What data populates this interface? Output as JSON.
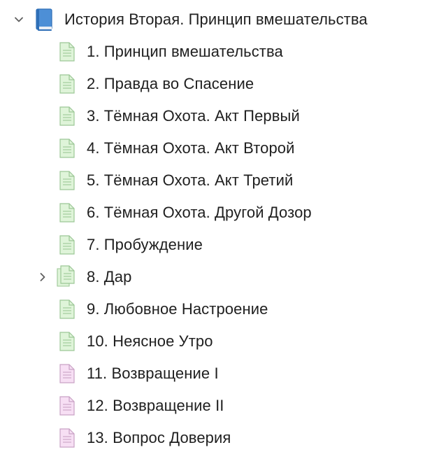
{
  "root": {
    "title": "История Вторая. Принцип вмешательства",
    "expanded": true,
    "icon": "book-icon"
  },
  "items": [
    {
      "label": "1. Принцип вмешательства",
      "icon": "document-green-icon",
      "color": "#dff4d9"
    },
    {
      "label": "2. Правда во Спасение",
      "icon": "document-green-icon",
      "color": "#dff4d9"
    },
    {
      "label": "3. Тёмная Охота. Акт Первый",
      "icon": "document-green-icon",
      "color": "#dff4d9"
    },
    {
      "label": "4. Тёмная Охота. Акт Второй",
      "icon": "document-green-icon",
      "color": "#dff4d9"
    },
    {
      "label": "5. Тёмная Охота. Акт Третий",
      "icon": "document-green-icon",
      "color": "#dff4d9"
    },
    {
      "label": "6. Тёмная Охота. Другой Дозор",
      "icon": "document-green-icon",
      "color": "#dff4d9"
    },
    {
      "label": "7. Пробуждение",
      "icon": "document-green-icon",
      "color": "#dff4d9"
    },
    {
      "label": "8. Дар",
      "icon": "documents-stack-green-icon",
      "color": "#dff4d9",
      "collapsed": true
    },
    {
      "label": "9. Любовное Настроение",
      "icon": "document-green-icon",
      "color": "#dff4d9"
    },
    {
      "label": "10. Неясное Утро",
      "icon": "document-green-icon",
      "color": "#dff4d9"
    },
    {
      "label": "11. Возвращение I",
      "icon": "document-pink-icon",
      "color": "#f7dff4"
    },
    {
      "label": "12. Возвращение II",
      "icon": "document-pink-icon",
      "color": "#f7dff4"
    },
    {
      "label": "13. Вопрос Доверия",
      "icon": "document-pink-icon",
      "color": "#f7dff4"
    }
  ]
}
